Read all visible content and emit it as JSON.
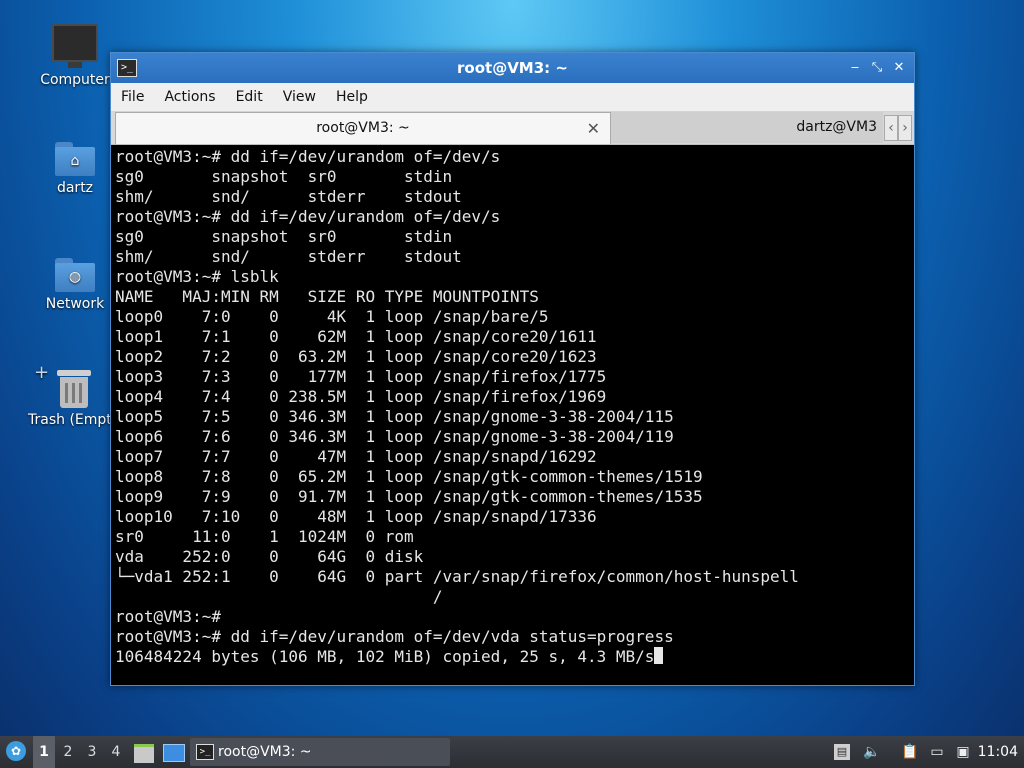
{
  "desktop": {
    "icons": [
      {
        "label": "Computer"
      },
      {
        "label": "dartz"
      },
      {
        "label": "Network"
      },
      {
        "label": "Trash (Empt"
      }
    ]
  },
  "window": {
    "title": "root@VM3: ~",
    "menu": [
      "File",
      "Actions",
      "Edit",
      "View",
      "Help"
    ],
    "tabs": [
      {
        "label": "root@VM3: ~",
        "active": true
      },
      {
        "label": "dartz@VM3",
        "active": false
      }
    ],
    "terminal_lines": [
      "root@VM3:~# dd if=/dev/urandom of=/dev/s",
      "sg0       snapshot  sr0       stdin",
      "shm/      snd/      stderr    stdout",
      "root@VM3:~# dd if=/dev/urandom of=/dev/s",
      "sg0       snapshot  sr0       stdin",
      "shm/      snd/      stderr    stdout",
      "root@VM3:~# lsblk",
      "NAME   MAJ:MIN RM   SIZE RO TYPE MOUNTPOINTS",
      "loop0    7:0    0     4K  1 loop /snap/bare/5",
      "loop1    7:1    0    62M  1 loop /snap/core20/1611",
      "loop2    7:2    0  63.2M  1 loop /snap/core20/1623",
      "loop3    7:3    0   177M  1 loop /snap/firefox/1775",
      "loop4    7:4    0 238.5M  1 loop /snap/firefox/1969",
      "loop5    7:5    0 346.3M  1 loop /snap/gnome-3-38-2004/115",
      "loop6    7:6    0 346.3M  1 loop /snap/gnome-3-38-2004/119",
      "loop7    7:7    0    47M  1 loop /snap/snapd/16292",
      "loop8    7:8    0  65.2M  1 loop /snap/gtk-common-themes/1519",
      "loop9    7:9    0  91.7M  1 loop /snap/gtk-common-themes/1535",
      "loop10   7:10   0    48M  1 loop /snap/snapd/17336",
      "sr0     11:0    1  1024M  0 rom",
      "vda    252:0    0    64G  0 disk",
      "└─vda1 252:1    0    64G  0 part /var/snap/firefox/common/host-hunspell",
      "                                 /",
      "root@VM3:~#",
      "root@VM3:~# dd if=/dev/urandom of=/dev/vda status=progress",
      "106484224 bytes (106 MB, 102 MiB) copied, 25 s, 4.3 MB/s"
    ]
  },
  "taskbar": {
    "workspaces": [
      "1",
      "2",
      "3",
      "4"
    ],
    "active_workspace": "1",
    "task_label": "root@VM3: ~",
    "clock": "11:04"
  }
}
